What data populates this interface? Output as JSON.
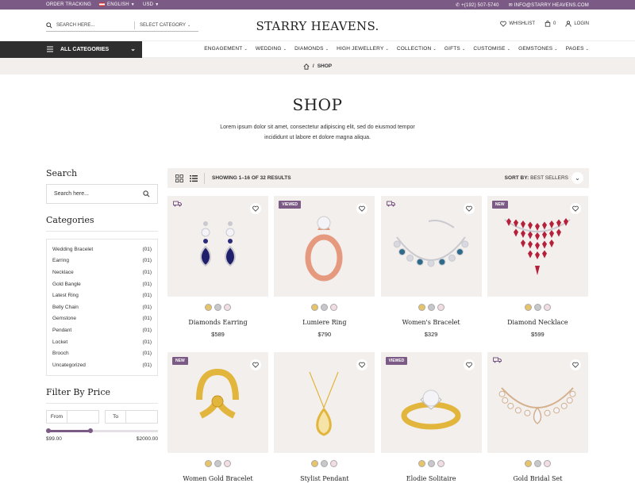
{
  "topbar": {
    "order_tracking": "ORDER TRACKING",
    "language": "ENGLISH",
    "currency": "USD",
    "phone": "+(192) 507-5740",
    "email": "INFO@STARRY HEAVENS.COM"
  },
  "header": {
    "search_placeholder": "SEARCH HERE...",
    "category_select": "SELECT CATEGORY",
    "logo": "STARRY HEAVENS.",
    "wishlist": "WHISHLIST",
    "cart_count": "0",
    "login": "LOGIN"
  },
  "nav": {
    "all_categories": "ALL CATEGORIES",
    "items": [
      "ENGAGEMENT",
      "WEDDING",
      "DIAMONDS",
      "HIGH JEWELLERY",
      "COLLECTION",
      "GIFTS",
      "CUSTOMISE",
      "GEMSTONES",
      "PAGES"
    ]
  },
  "breadcrumb": {
    "current": "SHOP",
    "separator": "/"
  },
  "page": {
    "title": "SHOP",
    "description": "Lorem ipsum dolor sit amet, consectetur adipiscing elit, sed do eiusmod tempor incididunt ut labore et dolore magna aliqua."
  },
  "sidebar": {
    "search_heading": "Search",
    "search_placeholder": "Search here...",
    "categories_heading": "Categories",
    "categories": [
      {
        "name": "Wedding Bracelet",
        "count": "(01)"
      },
      {
        "name": "Earring",
        "count": "(01)"
      },
      {
        "name": "Necklace",
        "count": "(01)"
      },
      {
        "name": "Gold Bangle",
        "count": "(01)"
      },
      {
        "name": "Latest Ring",
        "count": "(01)"
      },
      {
        "name": "Belly Chain",
        "count": "(01)"
      },
      {
        "name": "Gemstone",
        "count": "(01)"
      },
      {
        "name": "Pendant",
        "count": "(01)"
      },
      {
        "name": "Locket",
        "count": "(01)"
      },
      {
        "name": "Brooch",
        "count": "(01)"
      },
      {
        "name": "Uncategorized",
        "count": "(01)"
      }
    ],
    "filter_heading": "Filter By Price",
    "from_label": "From",
    "to_label": "To",
    "min_price": "$99.00",
    "max_price": "$2000.00",
    "range": {
      "low_fraction": 0.0,
      "high_fraction": 0.4
    }
  },
  "toolbar": {
    "showing": "SHOWING 1–16 OF 32 RESULTS",
    "sort_label": "SORT BY:",
    "sort_value": "BEST SELLERS"
  },
  "colors": {
    "accent": "#7b5a85",
    "panel": "#f3efed",
    "dark": "#2e2e2e"
  },
  "products": [
    {
      "name": "Diamonds Earring",
      "price": "$589",
      "badge": "",
      "truck": true,
      "icon": "earring"
    },
    {
      "name": "Lumiere Ring",
      "price": "$790",
      "badge": "VIEWED",
      "truck": false,
      "icon": "ring-rose"
    },
    {
      "name": "Women's Bracelet",
      "price": "$329",
      "badge": "",
      "truck": true,
      "icon": "bracelet"
    },
    {
      "name": "Diamond Necklace",
      "price": "$599",
      "badge": "NEW",
      "truck": false,
      "icon": "necklace"
    },
    {
      "name": "Women Gold Bracelet",
      "price": "",
      "badge": "NEW",
      "truck": false,
      "icon": "gold-bangle"
    },
    {
      "name": "Stylist Pendant",
      "price": "",
      "badge": "",
      "truck": false,
      "icon": "pendant"
    },
    {
      "name": "Elodie Solitaire",
      "price": "",
      "badge": "VIEWED",
      "truck": false,
      "icon": "solitaire"
    },
    {
      "name": "Gold Bridal Set",
      "price": "",
      "badge": "",
      "truck": true,
      "icon": "bridal-set"
    }
  ]
}
